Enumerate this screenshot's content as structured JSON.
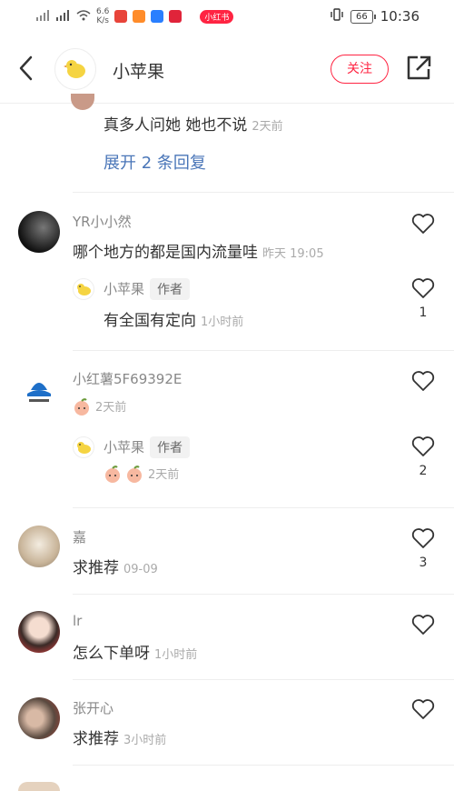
{
  "status": {
    "network": "6.6\nK/s",
    "app_pill": "小红书",
    "battery": "66",
    "time": "10:36"
  },
  "nav": {
    "title": "小苹果",
    "follow_label": "关注"
  },
  "thread": {
    "partial_reply_text": "真多人问她 她也不说",
    "partial_reply_time": "2天前",
    "expand_label": "展开 2 条回复"
  },
  "comments": [
    {
      "user": "YR小小然",
      "text": "哪个地方的都是国内流量哇",
      "time": "昨天 19:05",
      "reply": {
        "user": "小苹果",
        "tag": "作者",
        "text": "有全国有定向",
        "time": "1小时前",
        "likes": "1"
      }
    },
    {
      "user": "小红薯5F69392E",
      "text": "",
      "time": "2天前",
      "reply": {
        "user": "小苹果",
        "tag": "作者",
        "text": "",
        "time": "2天前",
        "likes": "2"
      }
    },
    {
      "user": "嘉",
      "text": "求推荐",
      "time": "09-09",
      "likes": "3"
    },
    {
      "user": "lr",
      "text": "怎么下单呀",
      "time": "1小时前",
      "likes": ""
    },
    {
      "user": "张开心",
      "text": "求推荐",
      "time": "3小时前",
      "likes": ""
    }
  ],
  "colors": {
    "brand": "#ff2442",
    "link": "#4a76b8"
  }
}
